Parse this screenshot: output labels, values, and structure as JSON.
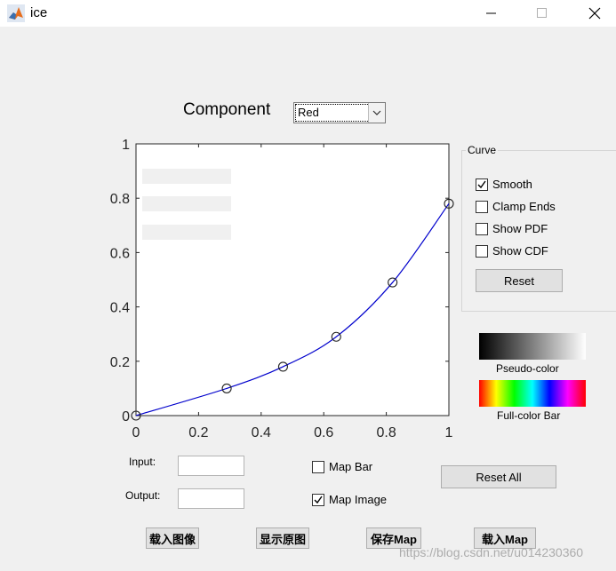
{
  "window": {
    "title": "ice",
    "icon": "matlab-icon",
    "controls": [
      "minimize-icon",
      "maximize-icon",
      "close-icon"
    ]
  },
  "component": {
    "label": "Component",
    "selected": "Red"
  },
  "chart_data": {
    "type": "line",
    "x": [
      0,
      0.29,
      0.47,
      0.64,
      0.82,
      1.0
    ],
    "y": [
      0.0,
      0.1,
      0.18,
      0.29,
      0.49,
      0.78
    ],
    "control_points": [
      [
        0,
        0.0
      ],
      [
        0.29,
        0.1
      ],
      [
        0.47,
        0.18
      ],
      [
        0.64,
        0.29
      ],
      [
        0.82,
        0.49
      ],
      [
        1.0,
        0.78
      ]
    ],
    "xlim": [
      0,
      1
    ],
    "ylim": [
      0,
      1
    ],
    "xticks": [
      "0",
      "0.2",
      "0.4",
      "0.6",
      "0.8",
      "1"
    ],
    "yticks": [
      "0",
      "0.2",
      "0.4",
      "0.6",
      "0.8",
      "1"
    ],
    "grid": false,
    "line_color": "#0000cc",
    "marker": "circle"
  },
  "curve_group": {
    "title": "Curve",
    "options": [
      {
        "label": "Smooth",
        "checked": true
      },
      {
        "label": "Clamp Ends",
        "checked": false
      },
      {
        "label": "Show PDF",
        "checked": false
      },
      {
        "label": "Show CDF",
        "checked": false
      }
    ],
    "reset_label": "Reset"
  },
  "bars": {
    "pseudo_label": "Pseudo-color",
    "full_label": "Full-color Bar"
  },
  "io": {
    "input_label": "Input:",
    "input_value": "",
    "output_label": "Output:",
    "output_value": ""
  },
  "map_options": {
    "map_bar": {
      "label": "Map Bar",
      "checked": false
    },
    "map_image": {
      "label": "Map Image",
      "checked": true
    }
  },
  "reset_all_label": "Reset All",
  "buttons": {
    "load_image": "载入图像",
    "show_original": "显示原图",
    "save_map": "保存Map",
    "load_map": "载入Map"
  },
  "watermark": "https://blog.csdn.net/u014230360",
  "colors": {
    "background": "#f0f0f0",
    "button": "#e1e1e1",
    "curve": "#0000cc"
  }
}
